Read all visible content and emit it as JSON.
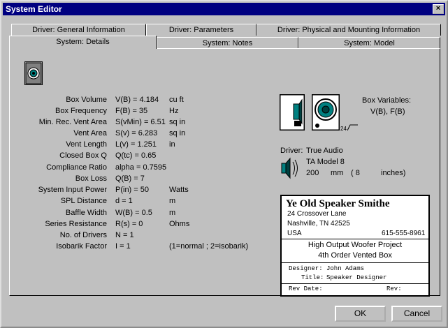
{
  "window": {
    "title": "System Editor",
    "close_glyph": "×"
  },
  "tabs_back": [
    "Driver:  General Information",
    "Driver:  Parameters",
    "Driver:  Physical and Mounting Information"
  ],
  "tabs_front": [
    "System:  Details",
    "System:  Notes",
    "System:  Model"
  ],
  "details": [
    {
      "label": "Box Volume",
      "expr": "V(B) = 4.184",
      "unit": "cu ft"
    },
    {
      "label": "Box Frequency",
      "expr": "F(B) = 35",
      "unit": "Hz"
    },
    {
      "label": "Min. Rec. Vent Area",
      "expr": "S(vMin) = 6.51",
      "unit": "sq in"
    },
    {
      "label": "Vent Area",
      "expr": "S(v) = 6.283",
      "unit": "sq in"
    },
    {
      "label": "Vent Length",
      "expr": "L(v) = 1.251",
      "unit": "in"
    },
    {
      "label": "Closed Box Q",
      "expr": "Q(tc) = 0.65",
      "unit": ""
    },
    {
      "label": "Compliance Ratio",
      "expr": "alpha = 0.7595",
      "unit": ""
    },
    {
      "label": "Box Loss",
      "expr": "Q(B) = 7",
      "unit": ""
    },
    {
      "label": "System Input Power",
      "expr": "P(in) = 50",
      "unit": "Watts"
    },
    {
      "label": "SPL Distance",
      "expr": "d = 1",
      "unit": "m"
    },
    {
      "label": "Baffle Width",
      "expr": "W(B) = 0.5",
      "unit": "m"
    },
    {
      "label": "Series Resistance",
      "expr": "R(s) = 0",
      "unit": "Ohms"
    },
    {
      "label": "No. of Drivers",
      "expr": "N = 1",
      "unit": ""
    },
    {
      "label": "Isobarik Factor",
      "expr": "I = 1",
      "unit": "(1=normal ; 2=isobarik)"
    }
  ],
  "box_variables": {
    "title": "Box Variables:",
    "value": "V(B), F(B)",
    "small_label": "24"
  },
  "driver": {
    "label": "Driver:",
    "brand": "True Audio",
    "model": "TA Model 8",
    "size_mm": "200",
    "mm_unit": "mm",
    "size_in": "( 8",
    "in_unit": "inches)"
  },
  "card": {
    "company": "Ye Old Speaker Smithe",
    "address1": "24 Crossover Lane",
    "address2": "Nashville, TN 42525",
    "country": "USA",
    "phone": "615-555-8961",
    "project1": "High Output Woofer Project",
    "project2": "4th Order Vented Box",
    "designer_label": "Designer:",
    "designer": "John Adams",
    "title_label": "Title:",
    "title_value": "Speaker Designer",
    "revdate_label": "Rev Date:",
    "rev_label": "Rev:"
  },
  "buttons": {
    "ok": "OK",
    "cancel": "Cancel"
  },
  "icons": {
    "speaker": "speaker-cabinet-icon",
    "box_side": "box-side-view-icon",
    "box_front": "box-front-view-icon",
    "driver": "driver-cone-icon"
  }
}
